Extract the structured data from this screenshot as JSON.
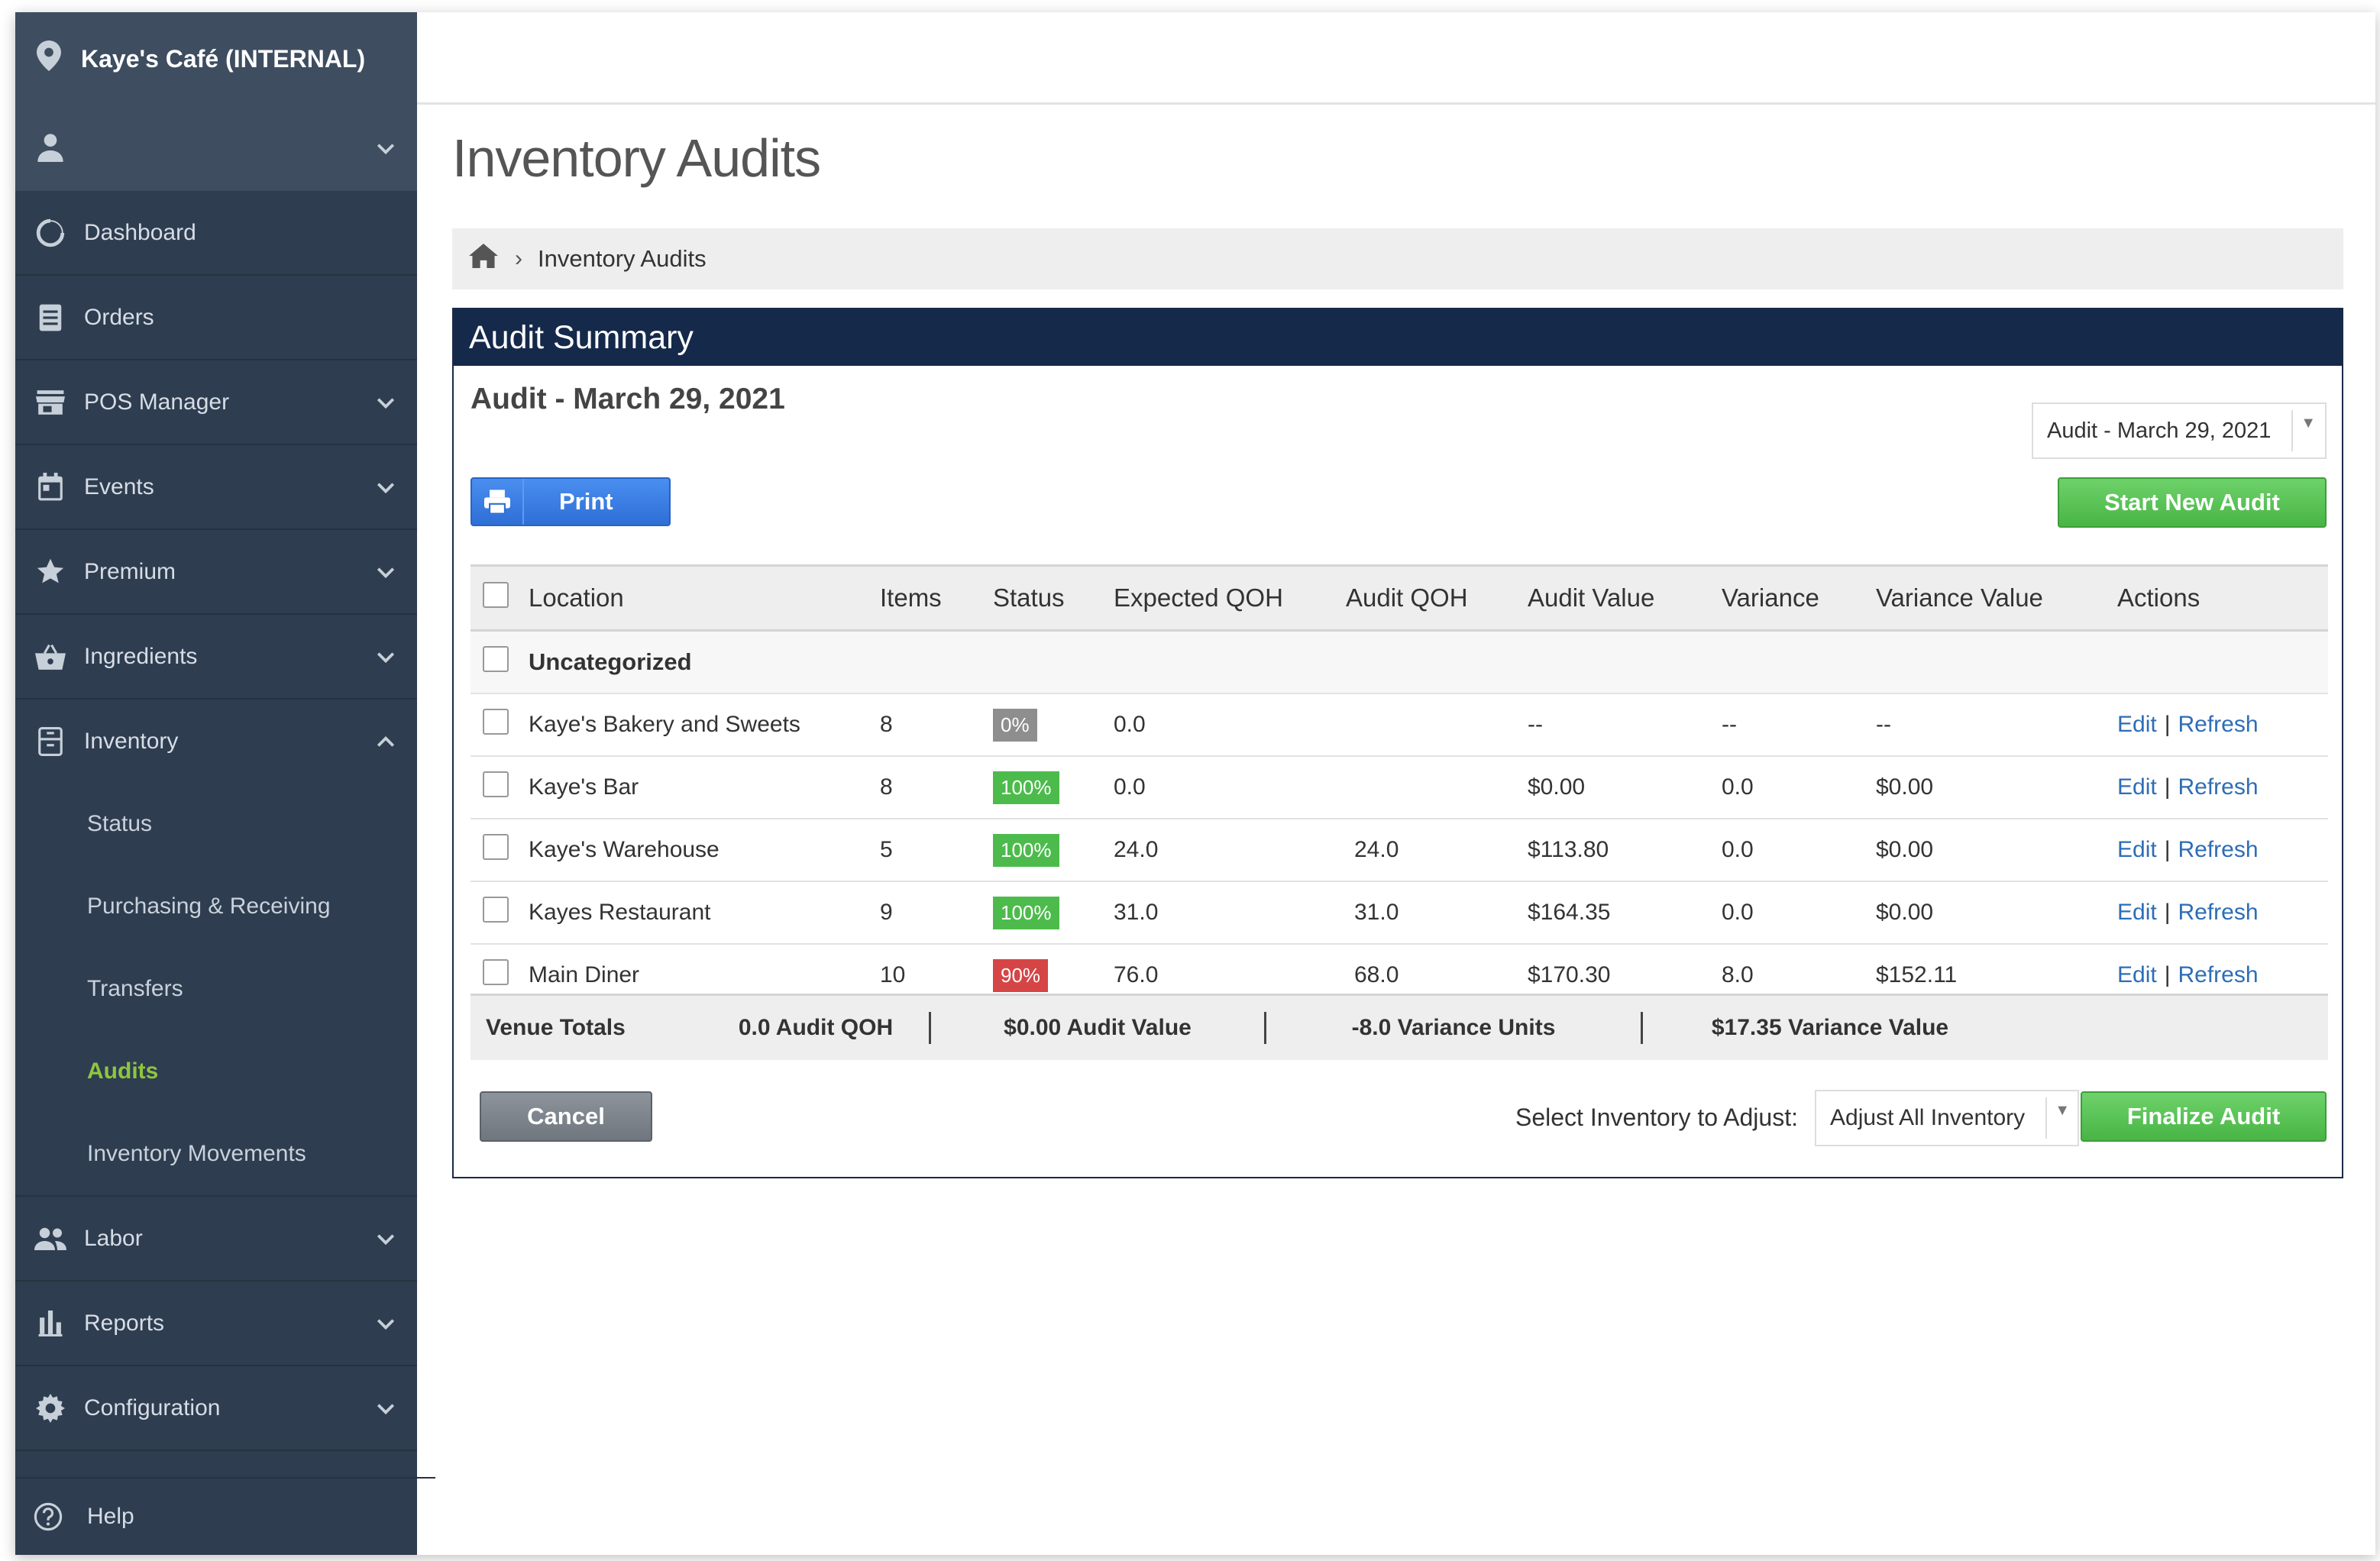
{
  "sidebar": {
    "venue": "Kaye's Café (INTERNAL)",
    "user_name": "",
    "nav": [
      {
        "label": "Dashboard",
        "icon": "dashboard-icon",
        "expandable": false
      },
      {
        "label": "Orders",
        "icon": "orders-icon",
        "expandable": false
      },
      {
        "label": "POS Manager",
        "icon": "store-icon",
        "expandable": true
      },
      {
        "label": "Events",
        "icon": "calendar-icon",
        "expandable": true
      },
      {
        "label": "Premium",
        "icon": "star-icon",
        "expandable": true
      },
      {
        "label": "Ingredients",
        "icon": "basket-icon",
        "expandable": true
      },
      {
        "label": "Inventory",
        "icon": "inventory-icon",
        "expandable": true,
        "expanded": true
      }
    ],
    "inventory_sub": [
      "Status",
      "Purchasing & Receiving",
      "Transfers",
      "Audits",
      "Inventory Movements"
    ],
    "active_sub": "Audits",
    "nav_after": [
      {
        "label": "Labor",
        "icon": "people-icon"
      },
      {
        "label": "Reports",
        "icon": "bar-chart-icon"
      },
      {
        "label": "Configuration",
        "icon": "gear-icon"
      }
    ],
    "help": "Help"
  },
  "page": {
    "title": "Inventory Audits",
    "breadcrumb": "Inventory Audits"
  },
  "panel": {
    "header": "Audit Summary",
    "audit_title": "Audit - March 29, 2021",
    "audit_select": "Audit - March 29, 2021",
    "print_label": "Print",
    "start_new_label": "Start New Audit"
  },
  "table": {
    "columns": [
      "Location",
      "Items",
      "Status",
      "Expected QOH",
      "Audit QOH",
      "Audit Value",
      "Variance",
      "Variance Value",
      "Actions"
    ],
    "category": "Uncategorized",
    "rows": [
      {
        "location": "Kaye's Bakery and Sweets",
        "items": "8",
        "status": "0%",
        "status_color": "#8e8e8e",
        "expected": "0.0",
        "audit_qoh": "",
        "audit_value": "--",
        "variance": "--",
        "variance_value": "--"
      },
      {
        "location": "Kaye's Bar",
        "items": "8",
        "status": "100%",
        "status_color": "#4cbb4c",
        "expected": "0.0",
        "audit_qoh": "",
        "audit_value": "$0.00",
        "variance": "0.0",
        "variance_value": "$0.00"
      },
      {
        "location": "Kaye's Warehouse",
        "items": "5",
        "status": "100%",
        "status_color": "#4cbb4c",
        "expected": "24.0",
        "audit_qoh": "24.0",
        "audit_value": "$113.80",
        "variance": "0.0",
        "variance_value": "$0.00"
      },
      {
        "location": "Kayes Restaurant",
        "items": "9",
        "status": "100%",
        "status_color": "#4cbb4c",
        "expected": "31.0",
        "audit_qoh": "31.0",
        "audit_value": "$164.35",
        "variance": "0.0",
        "variance_value": "$0.00"
      },
      {
        "location": "Main Diner",
        "items": "10",
        "status": "90%",
        "status_color": "#d64545",
        "expected": "76.0",
        "audit_qoh": "68.0",
        "audit_value": "$170.30",
        "variance": "8.0",
        "variance_value": "$152.11"
      }
    ],
    "edit_label": "Edit",
    "refresh_label": "Refresh",
    "separator": "|"
  },
  "totals": {
    "label": "Venue Totals",
    "audit_qoh": "0.0 Audit QOH",
    "audit_value": "$0.00 Audit Value",
    "variance_units": "-8.0 Variance Units",
    "variance_value": "$17.35 Variance Value"
  },
  "footer": {
    "cancel_label": "Cancel",
    "adjust_label": "Select Inventory to Adjust:",
    "adjust_value": "Adjust All Inventory",
    "finalize_label": "Finalize Audit"
  },
  "colors": {
    "sidebar_bg": "#2e3d50",
    "panel_header": "#15294a",
    "active_green": "#8dc63f",
    "link_blue": "#2d6db6"
  }
}
